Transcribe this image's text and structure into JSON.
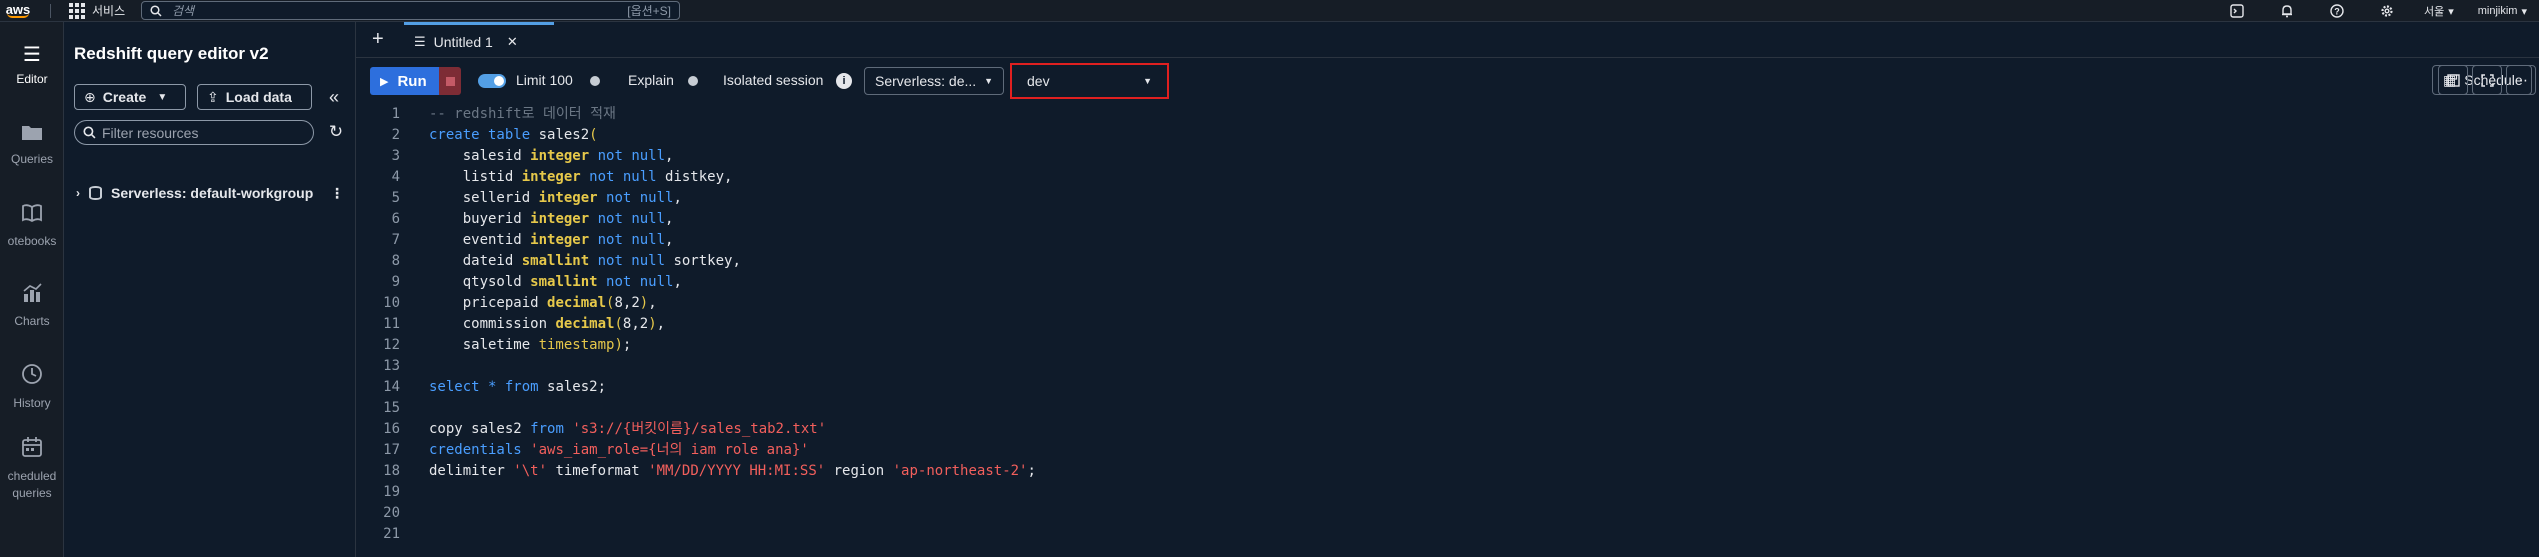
{
  "topnav": {
    "logo": "aws",
    "services_label": "서비스",
    "search_placeholder": "검색",
    "search_shortcut": "[옵션+S]",
    "region": "서울",
    "user": "minjikim",
    "icons": [
      "cloudshell-icon",
      "bell-icon",
      "help-icon",
      "gear-icon"
    ]
  },
  "rail": {
    "items": [
      {
        "label": "Editor",
        "icon": "editor-icon",
        "active": true
      },
      {
        "label": "Queries",
        "icon": "folder-icon",
        "active": false
      },
      {
        "label": "otebooks",
        "icon": "notebook-icon",
        "active": false
      },
      {
        "label": "Charts",
        "icon": "chart-icon",
        "active": false
      },
      {
        "label": "History",
        "icon": "clock-icon",
        "active": false
      },
      {
        "label": "cheduled",
        "label2": "queries",
        "icon": "calendar-icon",
        "active": false
      }
    ]
  },
  "panel": {
    "title": "Redshift query editor v2",
    "create_label": "Create",
    "load_label": "Load data",
    "filter_placeholder": "Filter resources",
    "tree": [
      {
        "label": "Serverless: default-workgroup"
      }
    ]
  },
  "editor": {
    "tab_label": "Untitled 1",
    "run_label": "Run",
    "limit_label": "Limit 100",
    "limit_on": true,
    "explain_label": "Explain",
    "explain_on": false,
    "isolated_label": "Isolated session",
    "isolated_on": false,
    "workgroup_select": "Serverless: de...",
    "database_select": "dev",
    "schedule_label": "Schedule",
    "line_numbers": [
      "1",
      "2",
      "3",
      "4",
      "5",
      "6",
      "7",
      "8",
      "9",
      "10",
      "11",
      "12",
      "13",
      "14",
      "15",
      "16",
      "17",
      "18",
      "19",
      "20",
      "21"
    ],
    "code_lines": [
      [
        [
          "cm",
          "-- redshift로 데이터 적재"
        ]
      ],
      [
        [
          "kw",
          "create table"
        ],
        [
          "pl",
          " sales2"
        ],
        [
          "pn",
          "("
        ]
      ],
      [
        [
          "pl",
          "    salesid "
        ],
        [
          "ty",
          "integer"
        ],
        [
          "nl",
          " not null"
        ],
        [
          "pl",
          ","
        ]
      ],
      [
        [
          "pl",
          "    listid "
        ],
        [
          "ty",
          "integer"
        ],
        [
          "nl",
          " not null"
        ],
        [
          "pl",
          " distkey,"
        ]
      ],
      [
        [
          "pl",
          "    sellerid "
        ],
        [
          "ty",
          "integer"
        ],
        [
          "nl",
          " not null"
        ],
        [
          "pl",
          ","
        ]
      ],
      [
        [
          "pl",
          "    buyerid "
        ],
        [
          "ty",
          "integer"
        ],
        [
          "nl",
          " not null"
        ],
        [
          "pl",
          ","
        ]
      ],
      [
        [
          "pl",
          "    eventid "
        ],
        [
          "ty",
          "integer"
        ],
        [
          "nl",
          " not null"
        ],
        [
          "pl",
          ","
        ]
      ],
      [
        [
          "pl",
          "    dateid "
        ],
        [
          "ty",
          "smallint"
        ],
        [
          "nl",
          " not null"
        ],
        [
          "pl",
          " sortkey,"
        ]
      ],
      [
        [
          "pl",
          "    qtysold "
        ],
        [
          "ty",
          "smallint"
        ],
        [
          "nl",
          " not null"
        ],
        [
          "pl",
          ","
        ]
      ],
      [
        [
          "pl",
          "    pricepaid "
        ],
        [
          "ty",
          "decimal"
        ],
        [
          "pn",
          "("
        ],
        [
          "pl",
          "8,2"
        ],
        [
          "pn",
          ")"
        ],
        [
          "pl",
          ","
        ]
      ],
      [
        [
          "pl",
          "    commission "
        ],
        [
          "ty",
          "decimal"
        ],
        [
          "pn",
          "("
        ],
        [
          "pl",
          "8,2"
        ],
        [
          "pn",
          ")"
        ],
        [
          "pl",
          ","
        ]
      ],
      [
        [
          "pl",
          "    saletime "
        ],
        [
          "pn",
          "timestamp"
        ],
        [
          "pn",
          ")"
        ],
        [
          "pl",
          ";"
        ]
      ],
      [],
      [
        [
          "kw",
          "select"
        ],
        [
          "op",
          " *"
        ],
        [
          "kw",
          " from"
        ],
        [
          "pl",
          " sales2;"
        ]
      ],
      [],
      [
        [
          "pl",
          "copy sales2 "
        ],
        [
          "kw",
          "from"
        ],
        [
          "pl",
          " "
        ],
        [
          "str",
          "'s3://{버킷이름}/sales_tab2.txt'"
        ]
      ],
      [
        [
          "kw",
          "credentials"
        ],
        [
          "pl",
          " "
        ],
        [
          "str",
          "'aws_iam_role={너의 iam role ana}'"
        ]
      ],
      [
        [
          "pl",
          "delimiter "
        ],
        [
          "str",
          "'\\t'"
        ],
        [
          "pl",
          " timeformat "
        ],
        [
          "str",
          "'MM/DD/YYYY HH:MI:SS'"
        ],
        [
          "pl",
          " region "
        ],
        [
          "str",
          "'ap-northeast-2'"
        ],
        [
          "pl",
          ";"
        ]
      ],
      [],
      [],
      []
    ]
  },
  "colors": {
    "accent": "#539fe5",
    "run_button": "#2d6fdd",
    "highlight_border": "#e02020",
    "keyword": "#4a9eff",
    "type": "#e6c84a",
    "string": "#f25f5c"
  }
}
